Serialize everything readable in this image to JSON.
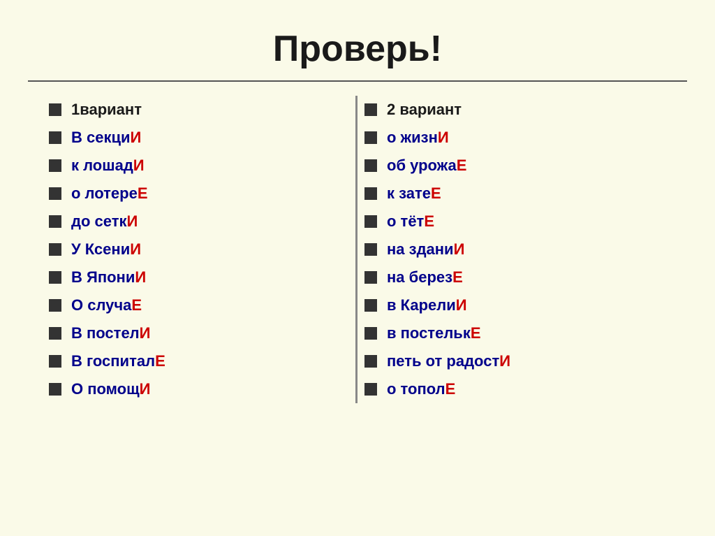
{
  "title": "Проверь!",
  "columns": [
    {
      "id": "col1",
      "items": [
        {
          "id": "v1-header",
          "base": "1вариант",
          "ending": "",
          "is_header": true
        },
        {
          "id": "v1-item1",
          "base": "В секци",
          "ending": "И"
        },
        {
          "id": "v1-item2",
          "base": "к лошад",
          "ending": "И"
        },
        {
          "id": "v1-item3",
          "base": "о лотере",
          "ending": "Е"
        },
        {
          "id": "v1-item4",
          "base": "до сетк",
          "ending": "И"
        },
        {
          "id": "v1-item5",
          "base": "У Ксени",
          "ending": "И"
        },
        {
          "id": "v1-item6",
          "base": "В Япони",
          "ending": "И"
        },
        {
          "id": "v1-item7",
          "base": "О случа",
          "ending": "Е"
        },
        {
          "id": "v1-item8",
          "base": "В постел",
          "ending": "И"
        },
        {
          "id": "v1-item9",
          "base": "В госпитал",
          "ending": "Е"
        },
        {
          "id": "v1-item10",
          "base": "О помощ",
          "ending": "И"
        }
      ]
    },
    {
      "id": "col2",
      "items": [
        {
          "id": "v2-header",
          "base": "2 вариант",
          "ending": "",
          "is_header": true
        },
        {
          "id": "v2-item1",
          "base": "о жизн",
          "ending": "И"
        },
        {
          "id": "v2-item2",
          "base": "об урожа",
          "ending": "Е"
        },
        {
          "id": "v2-item3",
          "base": "к зате",
          "ending": "Е"
        },
        {
          "id": "v2-item4",
          "base": "о тёт",
          "ending": "Е"
        },
        {
          "id": "v2-item5",
          "base": "на здани",
          "ending": "И"
        },
        {
          "id": "v2-item6",
          "base": "на берез",
          "ending": "Е"
        },
        {
          "id": "v2-item7",
          "base": "в Карели",
          "ending": "И"
        },
        {
          "id": "v2-item8",
          "base": "в постельк",
          "ending": "Е"
        },
        {
          "id": "v2-item9",
          "base": "петь от радост",
          "ending": "И"
        },
        {
          "id": "v2-item10",
          "base": "о тополЕ",
          "ending": ""
        }
      ]
    }
  ]
}
